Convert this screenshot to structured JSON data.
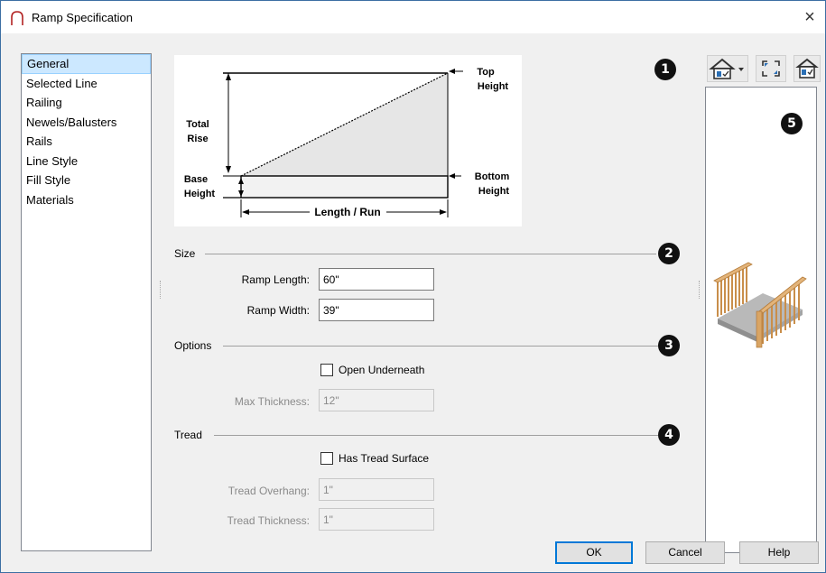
{
  "window": {
    "title": "Ramp Specification",
    "close_glyph": "×"
  },
  "sidebar": {
    "items": [
      {
        "label": "General"
      },
      {
        "label": "Selected Line"
      },
      {
        "label": "Railing"
      },
      {
        "label": "Newels/Balusters"
      },
      {
        "label": "Rails"
      },
      {
        "label": "Line Style"
      },
      {
        "label": "Fill Style"
      },
      {
        "label": "Materials"
      }
    ],
    "selected": "General"
  },
  "diagram": {
    "top_height": [
      "Top",
      "Height"
    ],
    "total_rise": [
      "Total",
      "Rise"
    ],
    "base_height": [
      "Base",
      "Height"
    ],
    "bottom_height": [
      "Bottom",
      "Height"
    ],
    "length_run": "Length / Run"
  },
  "badges": [
    "1",
    "2",
    "3",
    "4",
    "5"
  ],
  "size": {
    "heading": "Size",
    "ramp_length_label": "Ramp Length:",
    "ramp_length_value": "60\"",
    "ramp_width_label": "Ramp Width:",
    "ramp_width_value": "39\""
  },
  "options": {
    "heading": "Options",
    "open_underneath_label": "Open Underneath",
    "open_underneath_checked": false,
    "max_thickness_label": "Max Thickness:",
    "max_thickness_value": "12\""
  },
  "tread": {
    "heading": "Tread",
    "has_tread_surface_label": "Has Tread Surface",
    "has_tread_surface_checked": false,
    "tread_overhang_label": "Tread Overhang:",
    "tread_overhang_value": "1\"",
    "tread_thickness_label": "Tread Thickness:",
    "tread_thickness_value": "1\""
  },
  "toolbar": {
    "icons": [
      "camera-view-dropdown-icon",
      "fill-window-icon",
      "preview-toggle-icon"
    ]
  },
  "buttons": {
    "ok": "OK",
    "cancel": "Cancel",
    "help": "Help"
  },
  "colors": {
    "accent": "#0078d7",
    "selection": "#cce8ff",
    "rail_wood": "#e3b47a"
  }
}
